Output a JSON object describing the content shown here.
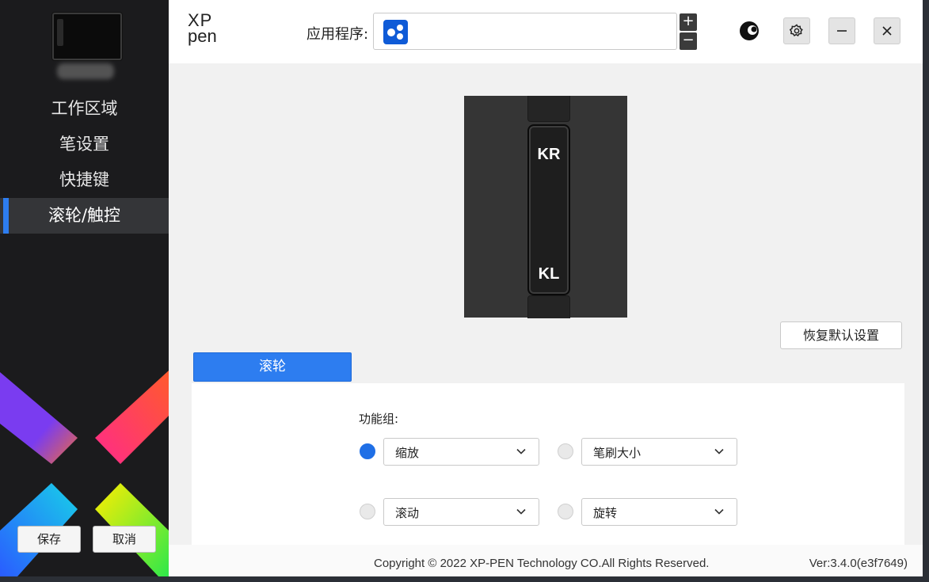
{
  "sidebar": {
    "nav": [
      {
        "label": "工作区域",
        "active": false
      },
      {
        "label": "笔设置",
        "active": false
      },
      {
        "label": "快捷键",
        "active": false
      },
      {
        "label": "滚轮/触控",
        "active": true
      }
    ],
    "save_label": "保存",
    "cancel_label": "取消"
  },
  "topbar": {
    "brand_line1": "XP",
    "brand_line2": "pen",
    "app_label": "应用程序:",
    "app_icon": "xppen-app-icon",
    "add_label": "+",
    "remove_label": "−",
    "icons": [
      "moon-icon",
      "gear-icon",
      "minimize-icon",
      "close-icon"
    ]
  },
  "device": {
    "ring_top_label": "KR",
    "ring_bottom_label": "KL"
  },
  "main": {
    "restore_label": "恢复默认设置",
    "tab_label": "滚轮",
    "func_group_label": "功能组:",
    "options": [
      {
        "value": "缩放",
        "selected": true
      },
      {
        "value": "笔刷大小",
        "selected": false
      },
      {
        "value": "滚动",
        "selected": false
      },
      {
        "value": "旋转",
        "selected": false
      }
    ]
  },
  "footer": {
    "copyright": "Copyright © 2022  XP-PEN Technology CO.All Rights Reserved.",
    "version": "Ver:3.4.0(e3f7649)"
  },
  "colors": {
    "accent": "#2d7df0",
    "sidebar_bg": "#1b1b1d",
    "app_icon_bg": "#0f5bd7"
  }
}
